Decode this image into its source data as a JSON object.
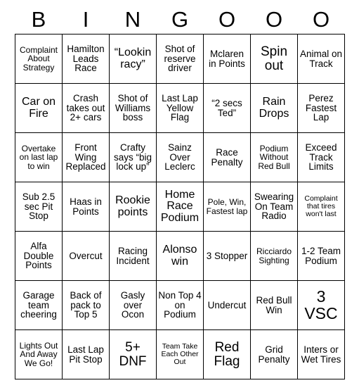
{
  "header": {
    "letters": [
      "B",
      "I",
      "N",
      "G",
      "O",
      "O",
      "O"
    ]
  },
  "grid": {
    "rows": 7,
    "cols": 7,
    "cells": [
      [
        {
          "text": "Complaint About Strategy",
          "size": "s-sm"
        },
        {
          "text": "Hamilton Leads Race",
          "size": "s-md"
        },
        {
          "text": "“Lookin racy”",
          "size": "s-lg"
        },
        {
          "text": "Shot of reserve driver",
          "size": "s-md"
        },
        {
          "text": "Mclaren in Points",
          "size": "s-md"
        },
        {
          "text": "Spin out",
          "size": "s-xl"
        },
        {
          "text": "Animal on Track",
          "size": "s-md"
        }
      ],
      [
        {
          "text": "Car on Fire",
          "size": "s-lg"
        },
        {
          "text": "Crash takes out 2+ cars",
          "size": "s-md"
        },
        {
          "text": "Shot of Williams boss",
          "size": "s-md"
        },
        {
          "text": "Last Lap Yellow Flag",
          "size": "s-md"
        },
        {
          "text": "“2 secs Ted”",
          "size": "s-md"
        },
        {
          "text": "Rain Drops",
          "size": "s-lg"
        },
        {
          "text": "Perez Fastest Lap",
          "size": "s-md"
        }
      ],
      [
        {
          "text": "Overtake on last lap to win",
          "size": "s-sm"
        },
        {
          "text": "Front Wing Replaced",
          "size": "s-md"
        },
        {
          "text": "Crafty says “big lock up”",
          "size": "s-md"
        },
        {
          "text": "Sainz Over Leclerc",
          "size": "s-md"
        },
        {
          "text": "Race Penalty",
          "size": "s-md"
        },
        {
          "text": "Podium Without Red Bull",
          "size": "s-sm"
        },
        {
          "text": "Exceed Track Limits",
          "size": "s-md"
        }
      ],
      [
        {
          "text": "Sub 2.5 sec Pit Stop",
          "size": "s-md"
        },
        {
          "text": "Haas in Points",
          "size": "s-md"
        },
        {
          "text": "Rookie points",
          "size": "s-lg"
        },
        {
          "text": "Home Race Podium",
          "size": "s-lg"
        },
        {
          "text": "Pole, Win, Fastest lap",
          "size": "s-sm"
        },
        {
          "text": "Swearing On Team Radio",
          "size": "s-md"
        },
        {
          "text": "Complaint that tires won't last",
          "size": "s-xs"
        }
      ],
      [
        {
          "text": "Alfa Double Points",
          "size": "s-md"
        },
        {
          "text": "Overcut",
          "size": "s-md"
        },
        {
          "text": "Racing Incident",
          "size": "s-md"
        },
        {
          "text": "Alonso win",
          "size": "s-lg"
        },
        {
          "text": "3 Stopper",
          "size": "s-md"
        },
        {
          "text": "Ricciardo Sighting",
          "size": "s-sm"
        },
        {
          "text": "1-2 Team Podium",
          "size": "s-md"
        }
      ],
      [
        {
          "text": "Garage team cheering",
          "size": "s-md"
        },
        {
          "text": "Back of pack to Top 5",
          "size": "s-md"
        },
        {
          "text": "Gasly over Ocon",
          "size": "s-md"
        },
        {
          "text": "Non Top 4 on Podium",
          "size": "s-md"
        },
        {
          "text": "Undercut",
          "size": "s-md"
        },
        {
          "text": "Red Bull Win",
          "size": "s-md"
        },
        {
          "text": "3 VSC",
          "size": "s-xxl"
        }
      ],
      [
        {
          "text": "Lights Out And Away We Go!",
          "size": "s-sm"
        },
        {
          "text": "Last Lap Pit Stop",
          "size": "s-md"
        },
        {
          "text": "5+ DNF",
          "size": "s-xl"
        },
        {
          "text": "Team Take Each Other Out",
          "size": "s-xs"
        },
        {
          "text": "Red Flag",
          "size": "s-xl"
        },
        {
          "text": "Grid Penalty",
          "size": "s-md"
        },
        {
          "text": "Inters or Wet Tires",
          "size": "s-md"
        }
      ]
    ]
  }
}
